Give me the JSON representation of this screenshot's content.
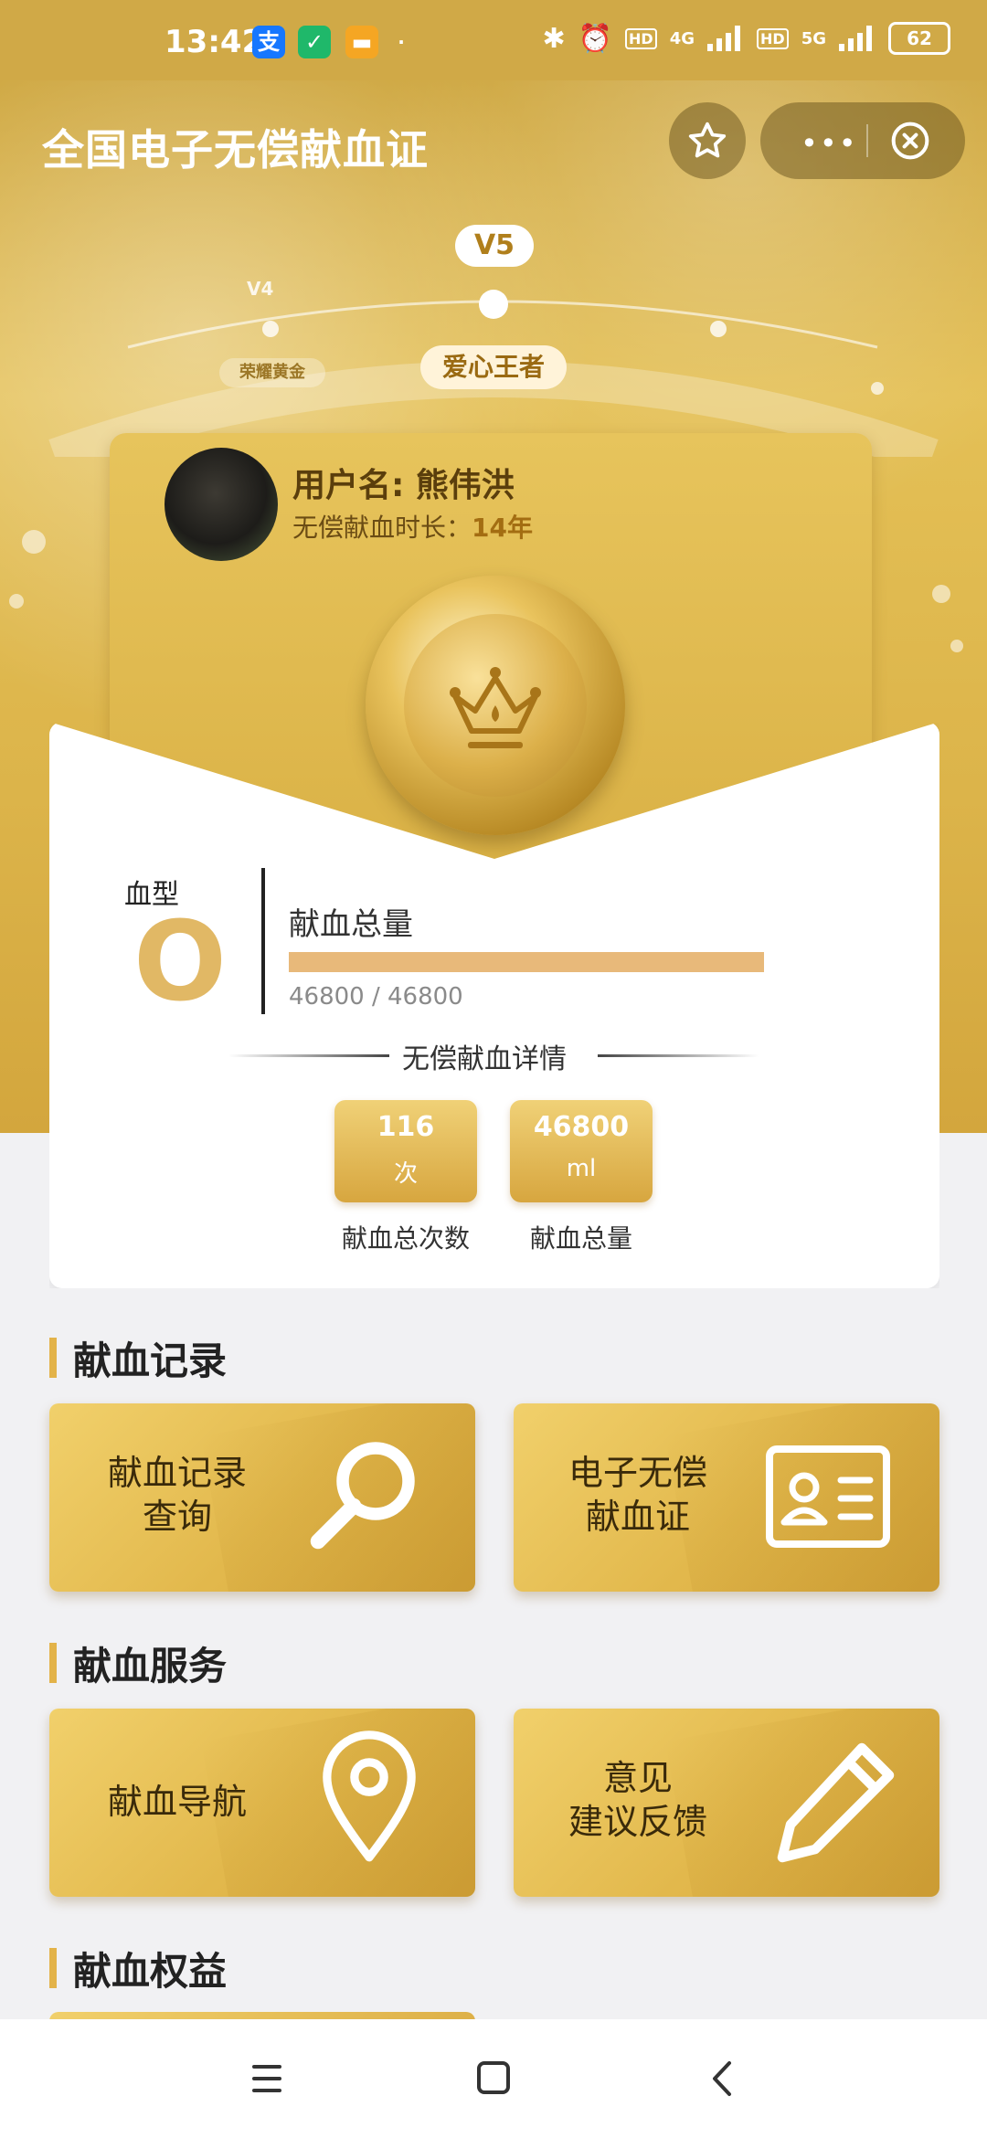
{
  "status_bar": {
    "time": "13:42",
    "battery": "62",
    "signal_1": "4G",
    "signal_2": "5G",
    "hd": "HD",
    "icons": [
      "alipay-icon",
      "shield-app-icon",
      "message-app-icon",
      "bluetooth-icon",
      "alarm-icon"
    ]
  },
  "title_bar": {
    "title": "全国电子无偿献血证",
    "more_icon": "more-dots-icon",
    "close_icon": "close-circle-icon",
    "star_icon": "star-icon"
  },
  "level": {
    "current": "V5",
    "previous": "V4",
    "current_title": "爱心王者",
    "previous_title": "荣耀黄金"
  },
  "profile": {
    "username": "用户名: 熊伟洪",
    "duration_label": "无偿献血时长：",
    "duration_value": "14年"
  },
  "blood": {
    "type_label": "血型",
    "type_value": "O",
    "total_label": "献血总量",
    "progress_text": "46800 / 46800",
    "progress_fraction": 1.0
  },
  "details": {
    "section_title": "无偿献血详情",
    "stats": [
      {
        "value": "116",
        "unit": "次",
        "caption": "献血总次数"
      },
      {
        "value": "46800",
        "unit": "ml",
        "caption": "献血总量"
      }
    ]
  },
  "sections": [
    {
      "title": "献血记录",
      "tiles": [
        {
          "label_line1": "献血记录",
          "label_line2": "查询",
          "icon": "magnifier-icon"
        },
        {
          "label_line1": "电子无偿",
          "label_line2": "献血证",
          "icon": "id-card-icon"
        }
      ]
    },
    {
      "title": "献血服务",
      "tiles": [
        {
          "label_line1": "献血导航",
          "label_line2": "",
          "icon": "location-pin-icon"
        },
        {
          "label_line1": "意见",
          "label_line2": "建议反馈",
          "icon": "pencil-icon"
        }
      ]
    },
    {
      "title": "献血权益",
      "tiles": []
    }
  ],
  "colors": {
    "gold": "#dcb44a",
    "gold_dark": "#b8861f",
    "progress": "#e8b97a",
    "blood_type": "#e1b865"
  },
  "nav_bar": {
    "icons": [
      "menu-icon",
      "home-square-icon",
      "back-chevron-icon"
    ]
  }
}
